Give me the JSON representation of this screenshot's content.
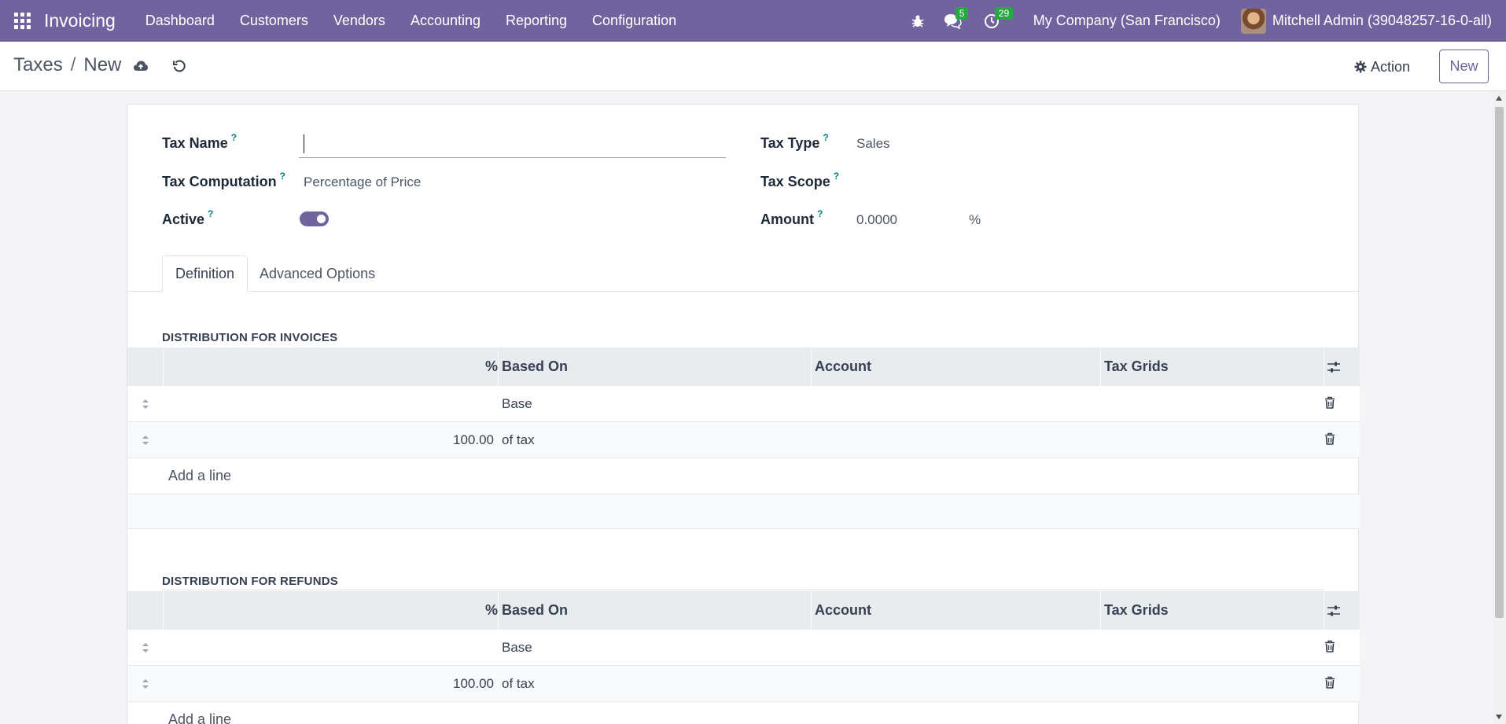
{
  "navbar": {
    "brand": "Invoicing",
    "menu": [
      "Dashboard",
      "Customers",
      "Vendors",
      "Accounting",
      "Reporting",
      "Configuration"
    ],
    "messages_badge": "5",
    "activities_badge": "29",
    "company": "My Company (San Francisco)",
    "user": "Mitchell Admin (39048257-16-0-all)"
  },
  "breadcrumb": {
    "parent": "Taxes",
    "separator": "/",
    "current": "New"
  },
  "controls": {
    "action_label": "Action",
    "new_label": "New"
  },
  "form": {
    "tax_name_label": "Tax Name",
    "tax_name_value": "",
    "tax_computation_label": "Tax Computation",
    "tax_computation_value": "Percentage of Price",
    "active_label": "Active",
    "active_value": true,
    "tax_type_label": "Tax Type",
    "tax_type_value": "Sales",
    "tax_scope_label": "Tax Scope",
    "tax_scope_value": "",
    "amount_label": "Amount",
    "amount_value": "0.0000",
    "amount_unit": "%",
    "help_mark": "?"
  },
  "tabs": [
    "Definition",
    "Advanced Options"
  ],
  "columns": [
    "%",
    "Based On",
    "Account",
    "Tax Grids"
  ],
  "invoices": {
    "title": "DISTRIBUTION FOR INVOICES",
    "rows": [
      {
        "percent": "",
        "based_on": "Base",
        "account": "",
        "tax_grids": ""
      },
      {
        "percent": "100.00",
        "based_on": "of tax",
        "account": "",
        "tax_grids": ""
      }
    ],
    "add_line": "Add a line"
  },
  "refunds": {
    "title": "DISTRIBUTION FOR REFUNDS",
    "rows": [
      {
        "percent": "",
        "based_on": "Base",
        "account": "",
        "tax_grids": ""
      },
      {
        "percent": "100.00",
        "based_on": "of tax",
        "account": "",
        "tax_grids": ""
      }
    ],
    "add_line": "Add a line"
  },
  "colors": {
    "primary": "#71639e",
    "badge": "#28a745",
    "help": "#017e84"
  }
}
